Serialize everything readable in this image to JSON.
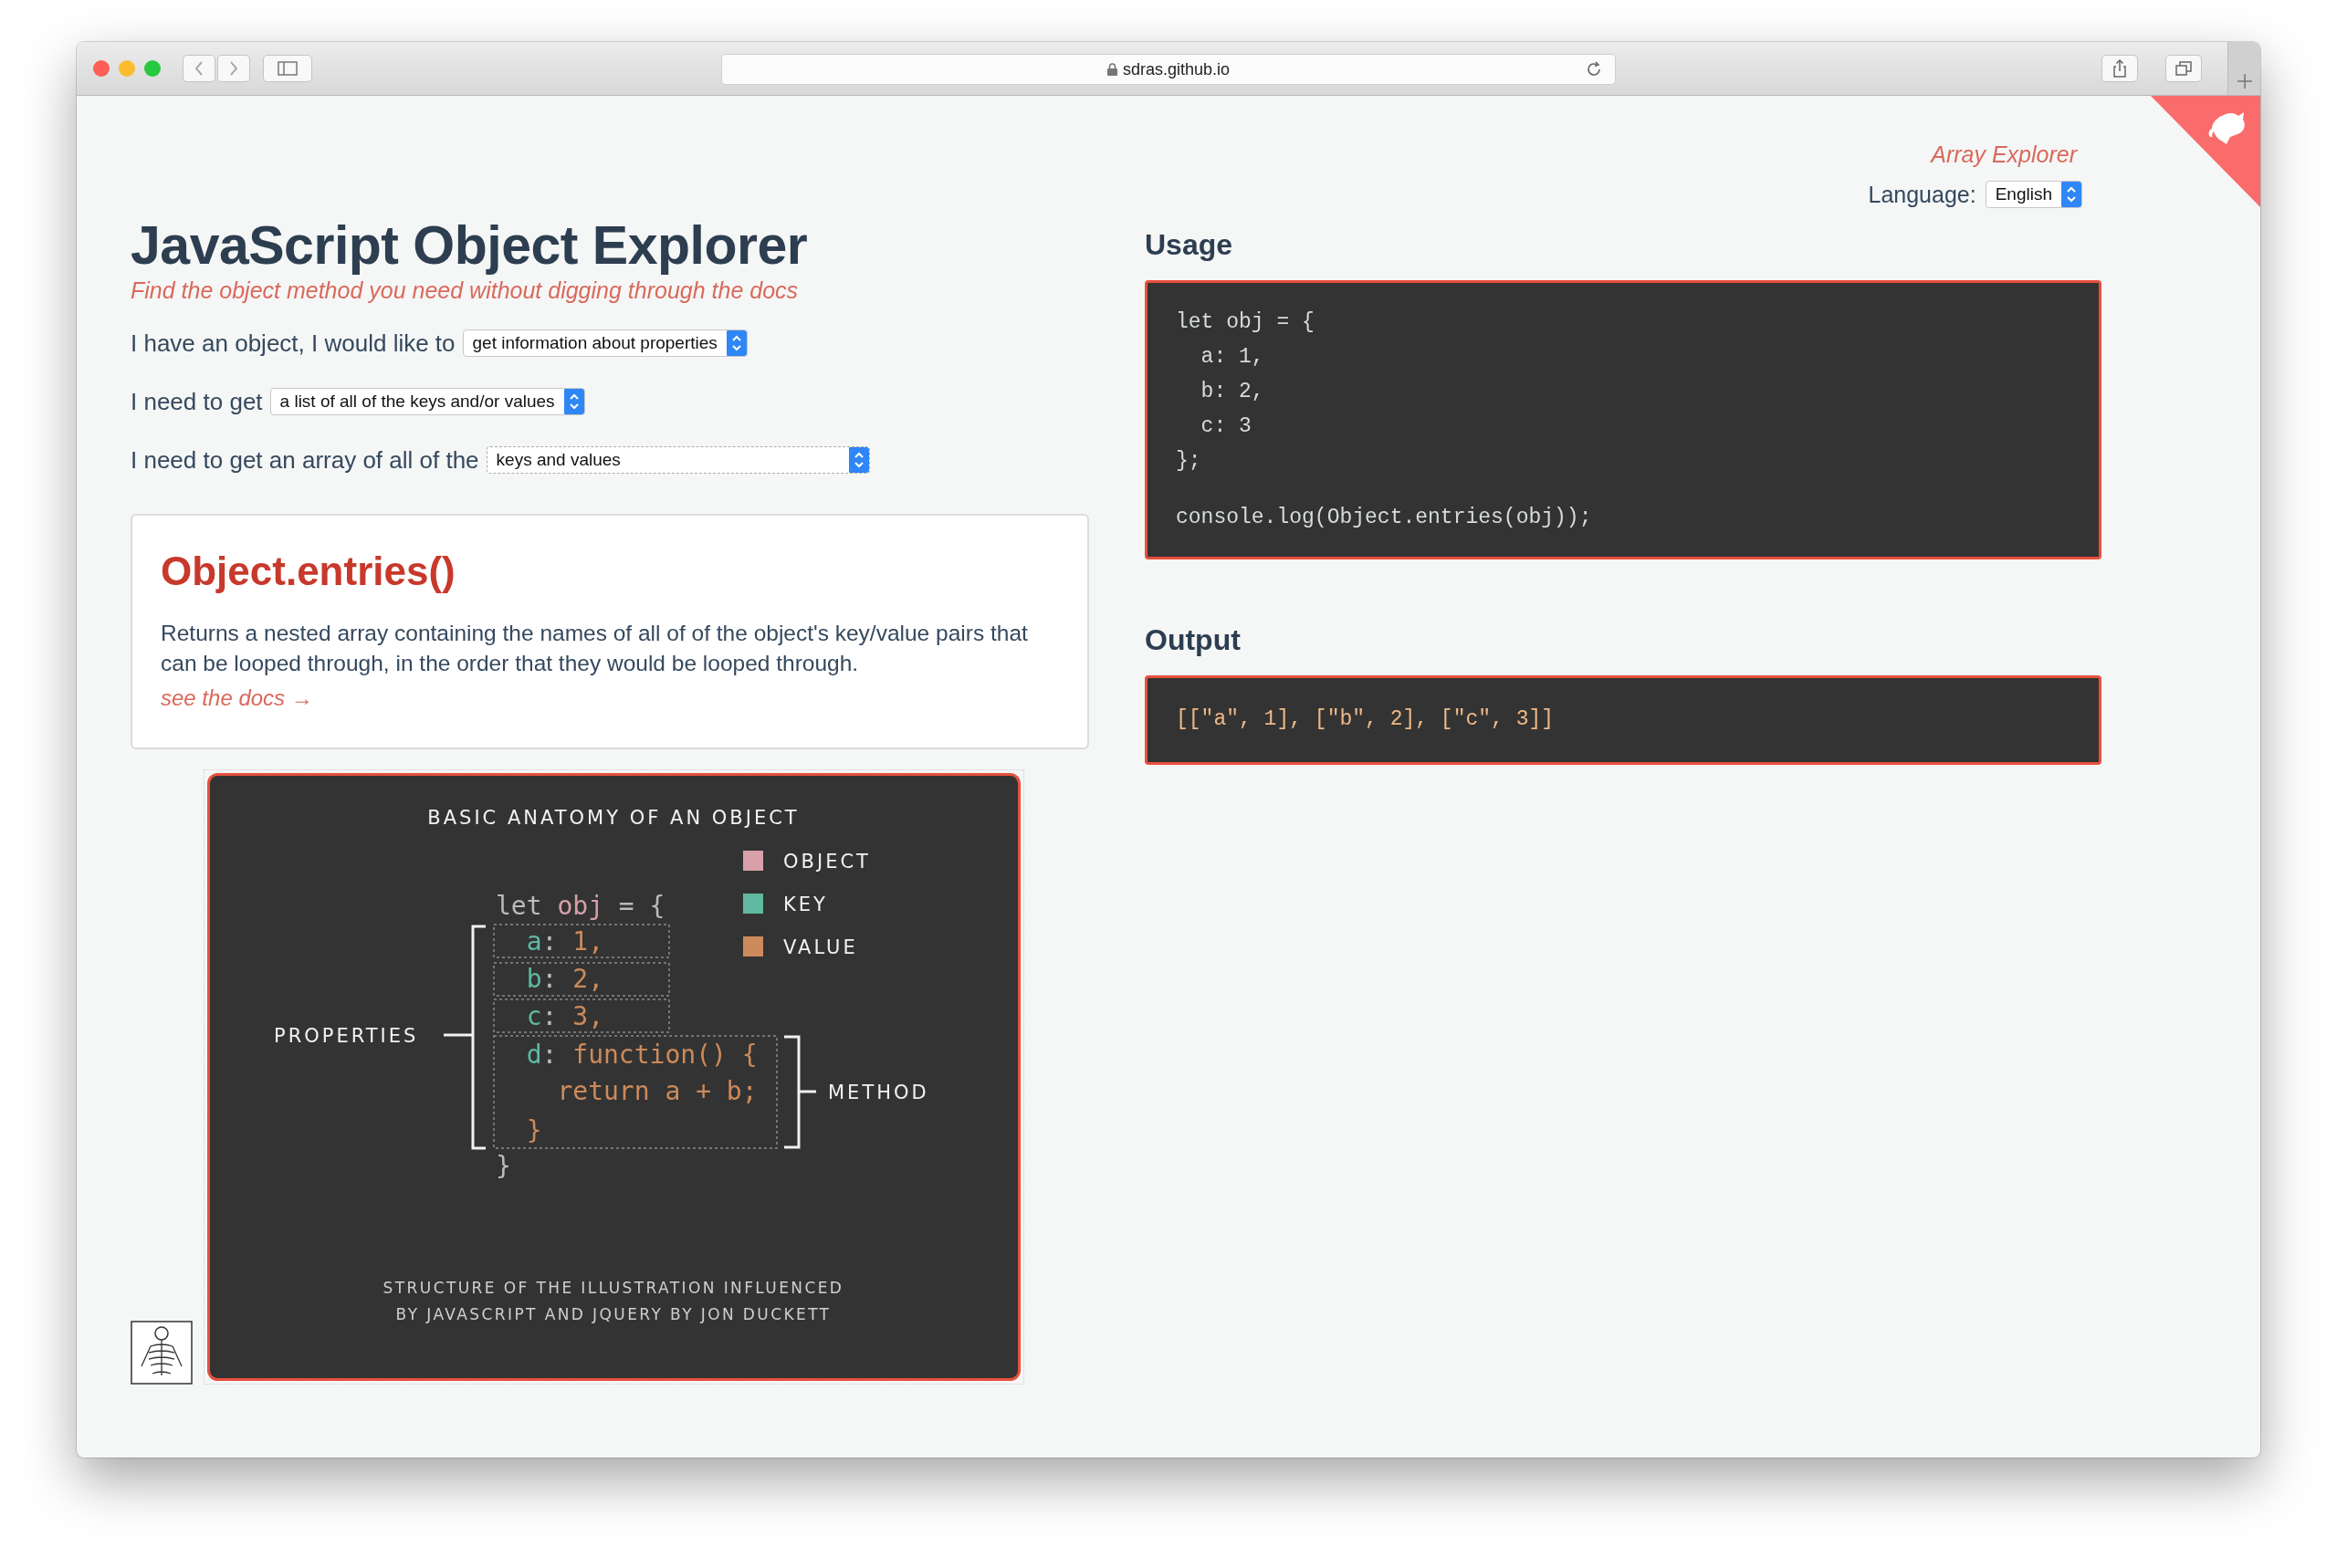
{
  "browser": {
    "url": "sdras.github.io"
  },
  "header": {
    "link": "Array Explorer",
    "language_label": "Language:",
    "language_value": "English"
  },
  "title": "JavaScript Object Explorer",
  "subtitle": "Find the object method you need without digging through the docs",
  "questions": [
    {
      "label": "I have an object, I would like to",
      "value": "get information about properties",
      "kind": "compact"
    },
    {
      "label": "I need to get",
      "value": "a list of all of the keys and/or values",
      "kind": "compact"
    },
    {
      "label": "I need to get an array of all of the",
      "value": "keys and values",
      "kind": "wide"
    }
  ],
  "method": {
    "name": "Object.entries()",
    "description": "Returns a nested array containing the names of all of of the object's key/value pairs that can be looped through, in the order that they would be looped through.",
    "docs_link": "see the docs →"
  },
  "diagram": {
    "title": "BASIC ANATOMY OF AN OBJECT",
    "legend": [
      {
        "label": "OBJECT",
        "kind": "object",
        "color": "#d8a0a8"
      },
      {
        "label": "KEY",
        "kind": "key",
        "color": "#5fb9a0"
      },
      {
        "label": "VALUE",
        "kind": "value",
        "color": "#cd8a5b"
      }
    ],
    "code_lines": [
      [
        {
          "text": "let ",
          "kind": "plain"
        },
        {
          "text": "obj",
          "kind": "object"
        },
        {
          "text": " = {",
          "kind": "plain"
        }
      ],
      [
        {
          "text": "  a",
          "kind": "key"
        },
        {
          "text": ": ",
          "kind": "plain"
        },
        {
          "text": "1,",
          "kind": "value"
        }
      ],
      [
        {
          "text": "  b",
          "kind": "key"
        },
        {
          "text": ": ",
          "kind": "plain"
        },
        {
          "text": "2,",
          "kind": "value"
        }
      ],
      [
        {
          "text": "  c",
          "kind": "key"
        },
        {
          "text": ": ",
          "kind": "plain"
        },
        {
          "text": "3,",
          "kind": "value"
        }
      ],
      [
        {
          "text": "  d",
          "kind": "key"
        },
        {
          "text": ": ",
          "kind": "plain"
        },
        {
          "text": "function() {",
          "kind": "value"
        }
      ],
      [
        {
          "text": "    return a + b;",
          "kind": "value"
        }
      ],
      [
        {
          "text": "  }",
          "kind": "value"
        }
      ],
      [
        {
          "text": "}",
          "kind": "plain"
        }
      ]
    ],
    "properties_label": "PROPERTIES",
    "method_label": "METHOD",
    "credit": [
      "STRUCTURE OF THE ILLUSTRATION INFLUENCED",
      "BY JAVASCRIPT AND JQUERY BY JON DUCKETT"
    ]
  },
  "usage": {
    "heading": "Usage",
    "code": [
      [
        "let obj = {",
        "  a: 1,",
        "  b: 2,",
        "  c: 3",
        "};"
      ],
      [
        "console.log(Object.entries(obj));"
      ]
    ]
  },
  "output": {
    "heading": "Output",
    "code": "[[\"a\", 1], [\"b\", 2], [\"c\", 3]]"
  }
}
